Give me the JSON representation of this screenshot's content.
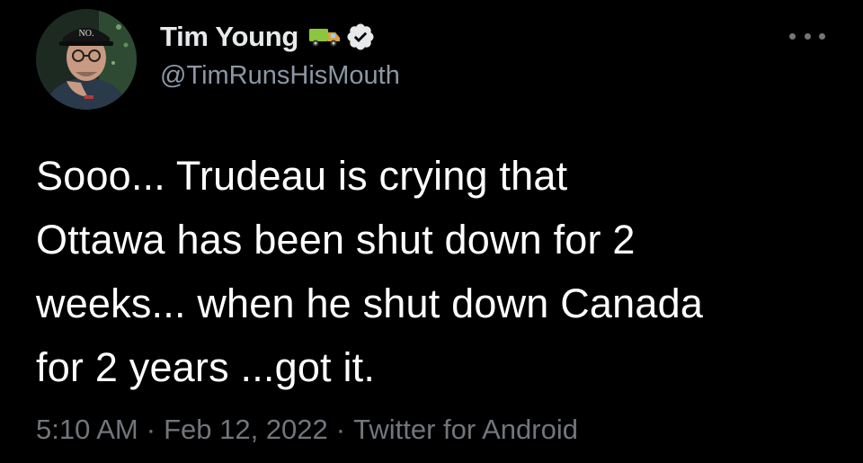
{
  "tweet": {
    "author": {
      "display_name": "Tim Young",
      "handle": "@TimRunsHisMouth",
      "name_emoji_icon": "truck-icon",
      "verified_icon": "verified-badge-icon",
      "avatar_cap_text": "NO."
    },
    "text_lines": [
      "Sooo... Trudeau is crying that",
      "Ottawa has been shut down for 2",
      "weeks... when he shut down Canada",
      "for 2 years ...got it."
    ],
    "meta": {
      "time": "5:10 AM",
      "date": "Feb 12, 2022",
      "source": "Twitter for Android",
      "separator": "·"
    },
    "more_icon": "more-horizontal-icon"
  },
  "colors": {
    "background": "#000000",
    "text_primary": "#e7e9ea",
    "text_secondary": "#71767b",
    "verified": "#e7e9ea"
  }
}
